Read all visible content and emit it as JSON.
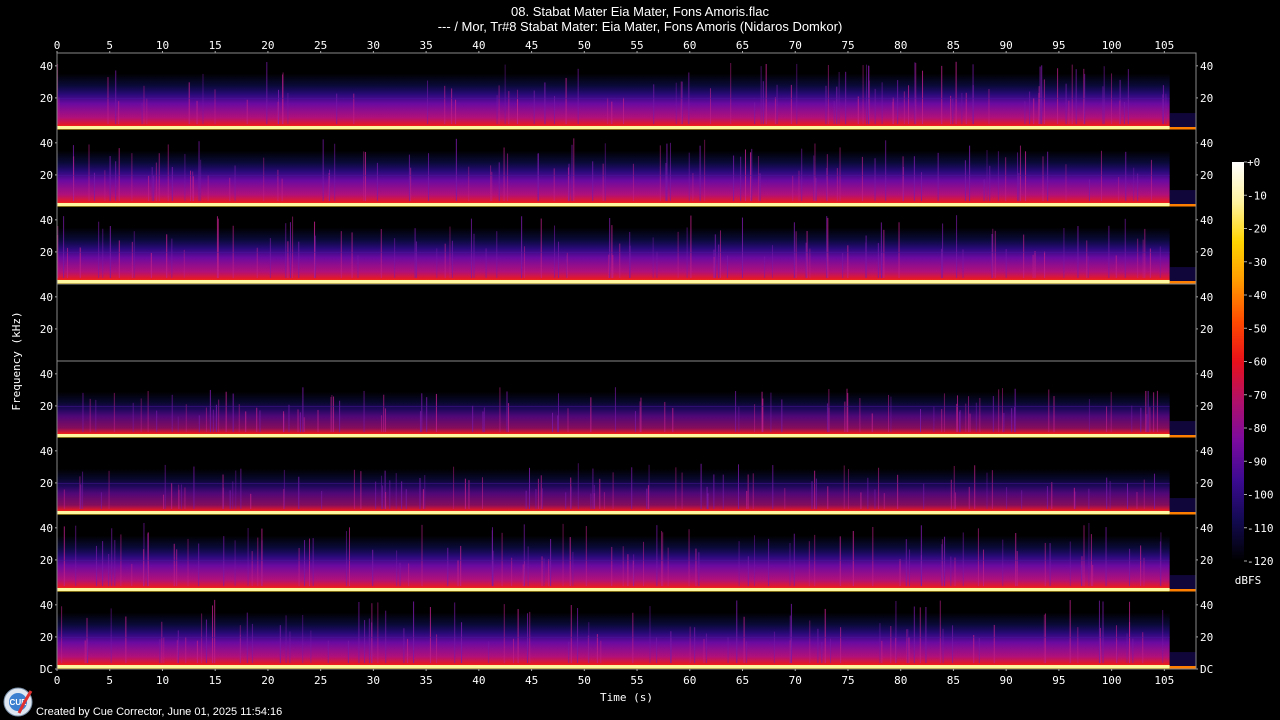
{
  "header": {
    "title": "08. Stabat Mater Eia Mater, Fons Amoris.flac",
    "subtitle": "--- / Mor, Tr#8 Stabat Mater: Eia Mater, Fons Amoris (Nidaros Domkor)"
  },
  "footer": {
    "credit": "Created by Cue Corrector, June 01, 2025 11:54:16",
    "logo_text": "CUE"
  },
  "chart_data": {
    "type": "heatmap",
    "xlabel": "Time (s)",
    "ylabel": "Frequency (kHz)",
    "colorbar_label": "dBFS",
    "x_ticks": [
      0,
      5,
      10,
      15,
      20,
      25,
      30,
      35,
      40,
      45,
      50,
      55,
      60,
      65,
      70,
      75,
      80,
      85,
      90,
      95,
      100,
      105
    ],
    "xlim": [
      0,
      108
    ],
    "channel_count": 8,
    "y_ticks_kHz": [
      20,
      40
    ],
    "y_tick_labels_last": [
      "DC",
      "20",
      "40"
    ],
    "ylim_kHz": [
      0,
      48
    ],
    "colorbar_ticks": [
      "+0",
      "-10",
      "-20",
      "-30",
      "-40",
      "-50",
      "-60",
      "-70",
      "-80",
      "-90",
      "-100",
      "-110",
      "-120"
    ],
    "colorbar_range_dB": [
      -120,
      0
    ],
    "channels": [
      {
        "index": 1,
        "silent": false,
        "bandwidth_kHz": 22,
        "intensity": 1.0
      },
      {
        "index": 2,
        "silent": false,
        "bandwidth_kHz": 22,
        "intensity": 1.0
      },
      {
        "index": 3,
        "silent": false,
        "bandwidth_kHz": 22,
        "intensity": 1.0
      },
      {
        "index": 4,
        "silent": true,
        "bandwidth_kHz": 0,
        "intensity": 0
      },
      {
        "index": 5,
        "silent": false,
        "bandwidth_kHz": 18,
        "intensity": 0.75
      },
      {
        "index": 6,
        "silent": false,
        "bandwidth_kHz": 18,
        "intensity": 0.75
      },
      {
        "index": 7,
        "silent": false,
        "bandwidth_kHz": 22,
        "intensity": 1.0
      },
      {
        "index": 8,
        "silent": false,
        "bandwidth_kHz": 22,
        "intensity": 1.0
      }
    ],
    "track_end_s": 105.5,
    "colors": [
      "#000000",
      "#0a0a3a",
      "#2a0a7a",
      "#6a0aa0",
      "#b0107a",
      "#e81a20",
      "#ff7a00",
      "#ffd400",
      "#ffffff"
    ]
  }
}
